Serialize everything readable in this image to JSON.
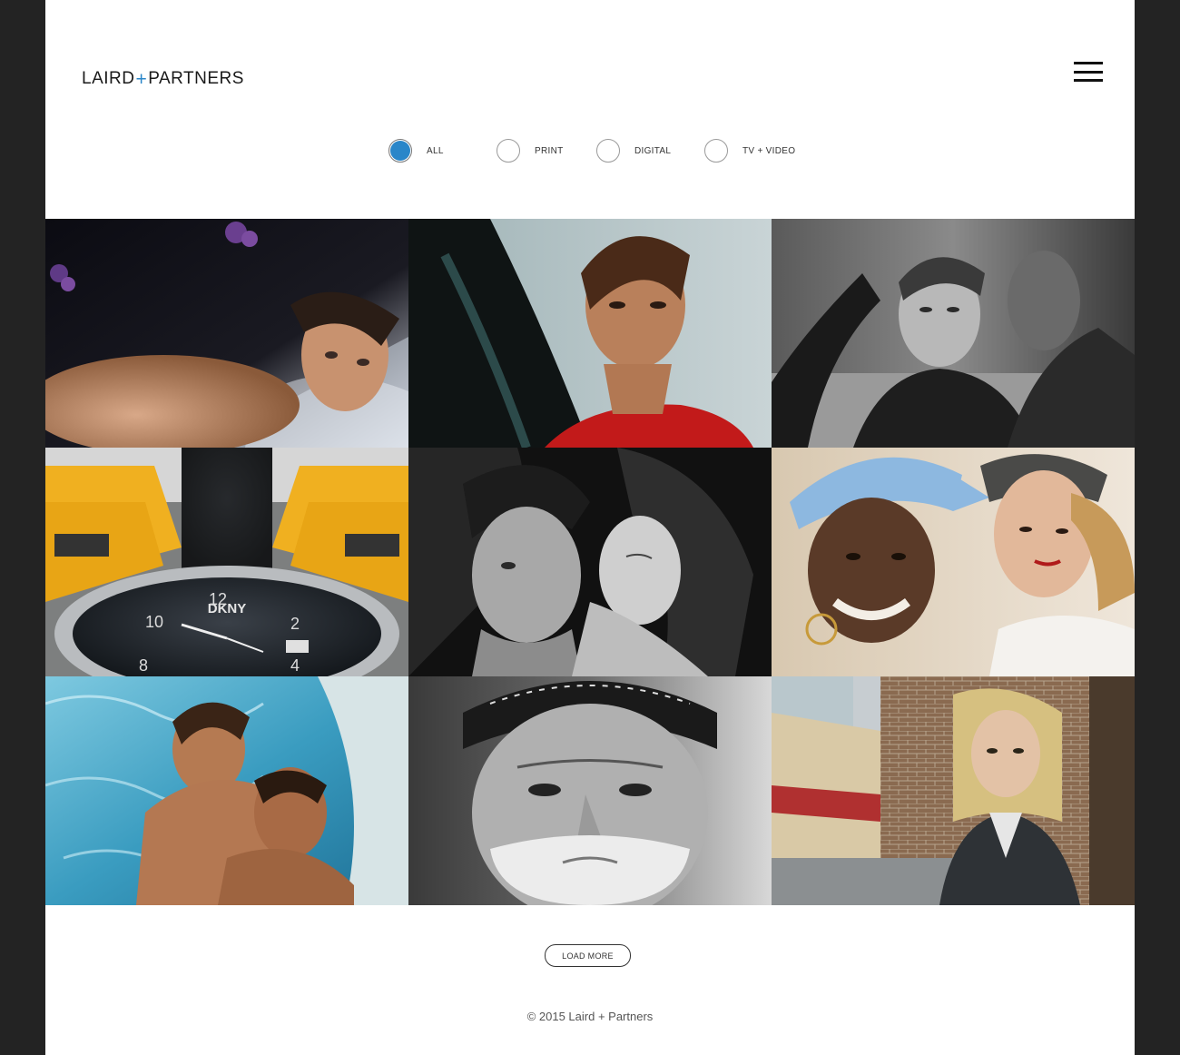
{
  "header": {
    "logo_left": "LAIRD",
    "logo_plus": "+",
    "logo_right": "PARTNERS",
    "menu_icon": "hamburger-menu-icon"
  },
  "filters": [
    {
      "label": "ALL",
      "selected": true
    },
    {
      "label": "PRINT",
      "selected": false
    },
    {
      "label": "DIGITAL",
      "selected": false
    },
    {
      "label": "TV + VIDEO",
      "selected": false
    }
  ],
  "grid": {
    "tiles": [
      {
        "subject": "woman in water with orchids"
      },
      {
        "subject": "woman in red with brush stroke"
      },
      {
        "subject": "man in leather jacket, black and white"
      },
      {
        "subject": "DKNY watch with yellow taxi cabs"
      },
      {
        "subject": "couple embracing, black and white"
      },
      {
        "subject": "two women in caps"
      },
      {
        "subject": "couple in swimming pool"
      },
      {
        "subject": "older man with bandana, black and white"
      },
      {
        "subject": "woman by brick wall"
      }
    ],
    "watch_brand": "DKNY",
    "watch_numbers": [
      "12",
      "10",
      "2",
      "8",
      "4"
    ]
  },
  "load_more_label": "LOAD MORE",
  "footer_text": "© 2015 Laird + Partners",
  "colors": {
    "accent": "#2a86c9",
    "frame": "#232323",
    "page": "#ffffff"
  }
}
